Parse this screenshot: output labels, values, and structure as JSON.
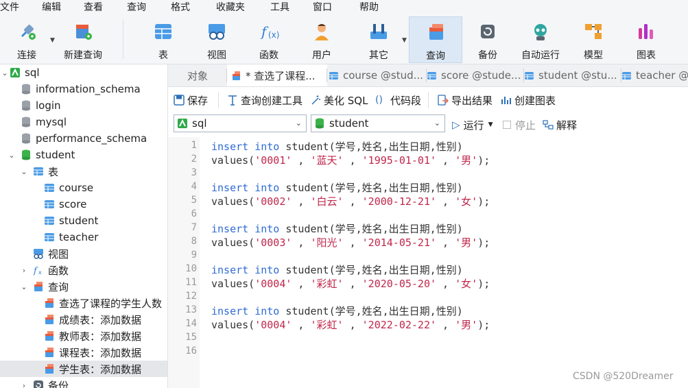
{
  "menu": [
    "文件",
    "编辑",
    "查看",
    "查询",
    "格式",
    "收藏夹",
    "工具",
    "窗口",
    "帮助"
  ],
  "toolbar": {
    "connect": "连接",
    "new_query": "新建查询",
    "table": "表",
    "view": "视图",
    "function": "函数",
    "user": "用户",
    "other": "其它",
    "query": "查询",
    "backup": "备份",
    "auto_run": "自动运行",
    "model": "模型",
    "chart": "图表"
  },
  "sidebar": {
    "connection": "sql",
    "databases": [
      "information_schema",
      "login",
      "mysql",
      "performance_schema",
      "student"
    ],
    "tables_label": "表",
    "tables": [
      "course",
      "score",
      "student",
      "teacher"
    ],
    "views_label": "视图",
    "functions_label": "函数",
    "queries_label": "查询",
    "queries": [
      "查选了课程的学生人数",
      "成绩表：添加数据",
      "教师表：添加数据",
      "课程表：添加数据",
      "学生表：添加数据"
    ],
    "backup_label": "备份"
  },
  "tabs": [
    "对象",
    "* 查选了课程...",
    "course @stud...",
    "score @stude...",
    "student @stu...",
    "teacher @s"
  ],
  "editor_toolbar": {
    "save": "保存",
    "query_builder": "查询创建工具",
    "beautify": "美化 SQL",
    "snippet": "代码段",
    "export": "导出结果",
    "create_chart": "创建图表"
  },
  "selectors": {
    "connection": "sql",
    "database": "student",
    "run": "运行",
    "stop": "停止",
    "explain": "解释"
  },
  "code_lines": [
    {
      "n": "1",
      "kw1": "insert",
      "kw2": "into",
      "rest": " student(学号,姓名,出生日期,性别)"
    },
    {
      "n": "2",
      "v": [
        "'0001'",
        "'蓝天'",
        "'1995-01-01'",
        "'男'"
      ]
    },
    {
      "n": "3"
    },
    {
      "n": "4",
      "kw1": "insert",
      "kw2": "into",
      "rest": " student(学号,姓名,出生日期,性别)"
    },
    {
      "n": "5",
      "v": [
        "'0002'",
        "'白云'",
        "'2000-12-21'",
        "'女'"
      ]
    },
    {
      "n": "6"
    },
    {
      "n": "7",
      "kw1": "insert",
      "kw2": "into",
      "rest": " student(学号,姓名,出生日期,性别)"
    },
    {
      "n": "8",
      "v": [
        "'0003'",
        "'阳光'",
        "'2014-05-21'",
        "'男'"
      ]
    },
    {
      "n": "9"
    },
    {
      "n": "10",
      "kw1": "insert",
      "kw2": "into",
      "rest": " student(学号,姓名,出生日期,性别)"
    },
    {
      "n": "11",
      "v": [
        "'0004'",
        "'彩虹'",
        "'2020-05-20'",
        "'女'"
      ]
    },
    {
      "n": "12"
    },
    {
      "n": "13",
      "kw1": "insert",
      "kw2": "into",
      "rest": " student(学号,姓名,出生日期,性别)"
    },
    {
      "n": "14",
      "v": [
        "'0004'",
        "'彩虹'",
        "'2022-02-22'",
        "'男'"
      ]
    },
    {
      "n": "15"
    },
    {
      "n": "16"
    }
  ],
  "watermark": "CSDN @520Dreamer"
}
